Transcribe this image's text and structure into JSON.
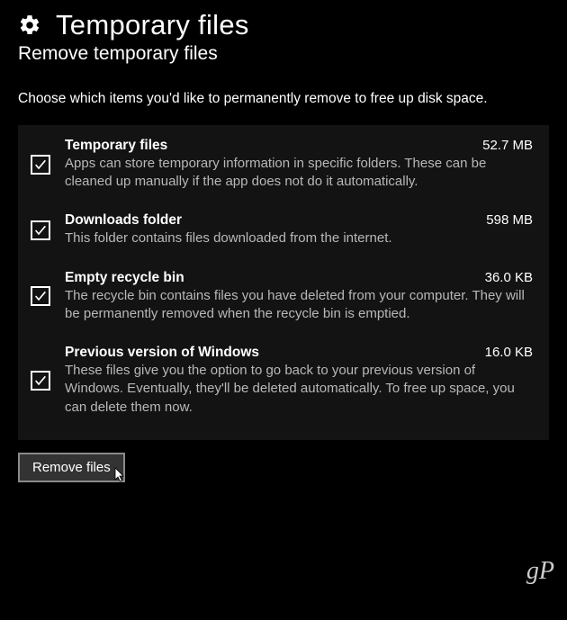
{
  "header": {
    "title": "Temporary files",
    "subtitle": "Remove temporary files"
  },
  "intro": "Choose which items you'd like to permanently remove to free up disk space.",
  "items": [
    {
      "title": "Temporary files",
      "size": "52.7 MB",
      "desc": "Apps can store temporary information in specific folders. These can be cleaned up manually if the app does not do it automatically.",
      "checked": true
    },
    {
      "title": "Downloads folder",
      "size": "598 MB",
      "desc": "This folder contains files downloaded from the internet.",
      "checked": true
    },
    {
      "title": "Empty recycle bin",
      "size": "36.0 KB",
      "desc": "The recycle bin contains files you have deleted from your computer. They will be permanently removed when the recycle bin is emptied.",
      "checked": true
    },
    {
      "title": "Previous version of Windows",
      "size": "16.0 KB",
      "desc": "These files give you the option to go back to your previous version of Windows. Eventually, they'll be deleted automatically. To free up space, you can delete them now.",
      "checked": true
    }
  ],
  "button": {
    "label": "Remove files"
  },
  "watermark": "gP"
}
